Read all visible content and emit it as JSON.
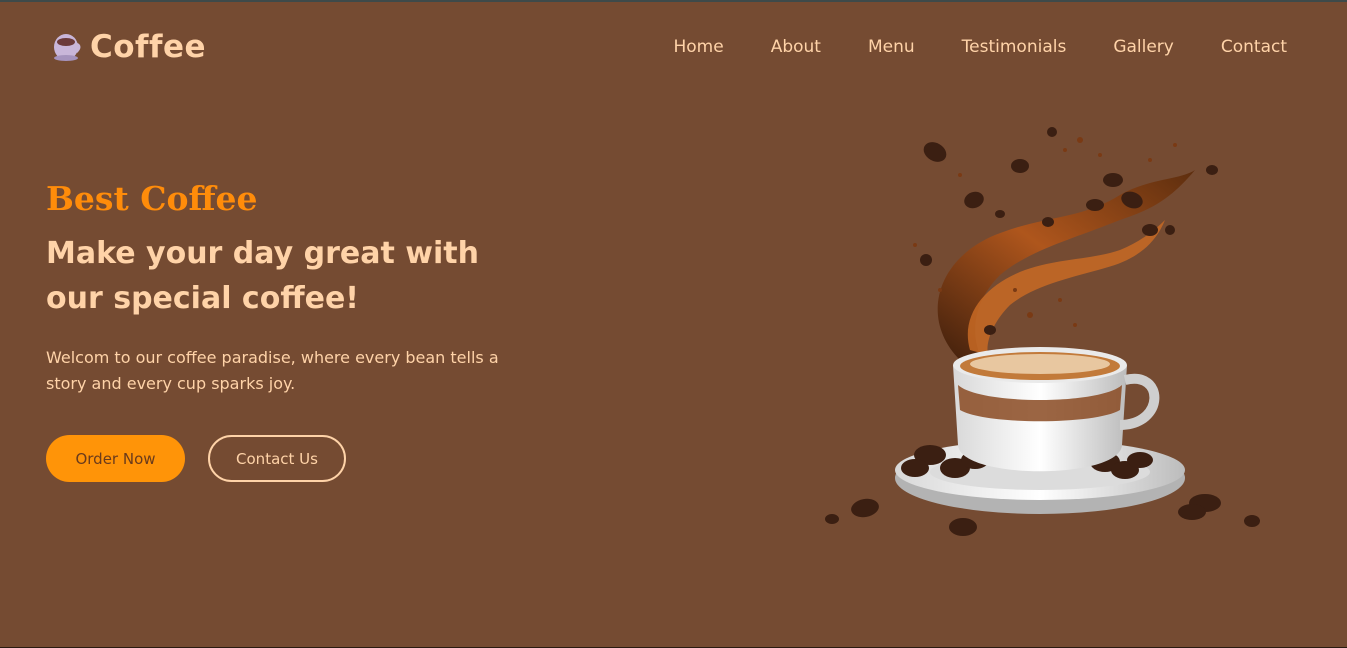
{
  "brand": {
    "name": "Coffee",
    "icon": "coffee-cup-icon"
  },
  "nav": {
    "items": [
      {
        "label": "Home"
      },
      {
        "label": "About"
      },
      {
        "label": "Menu"
      },
      {
        "label": "Testimonials"
      },
      {
        "label": "Gallery"
      },
      {
        "label": "Contact"
      }
    ]
  },
  "hero": {
    "kicker": "Best Coffee",
    "headline": "Make your day great with our special coffee!",
    "description": "Welcom to our coffee paradise, where every bean tells a story and every cup sparks joy.",
    "primary_button": "Order Now",
    "secondary_button": "Contact Us",
    "image": "coffee-splash-cup-illustration"
  },
  "colors": {
    "background": "#754b32",
    "accent": "#ff9408",
    "text": "#ffd3a8"
  }
}
